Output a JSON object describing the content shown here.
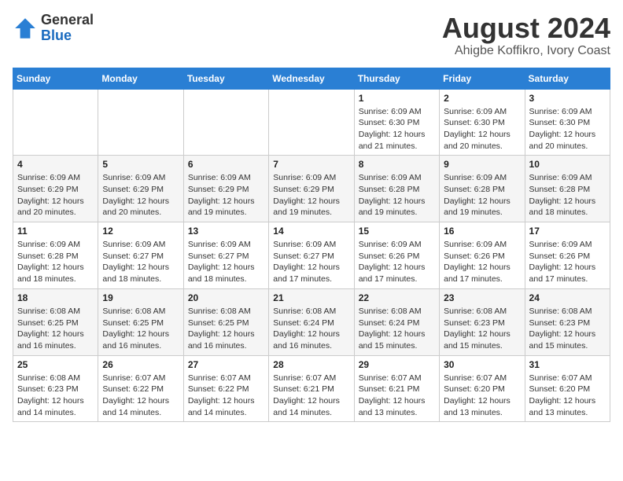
{
  "logo": {
    "general": "General",
    "blue": "Blue"
  },
  "header": {
    "month": "August 2024",
    "location": "Ahigbe Koffikro, Ivory Coast"
  },
  "weekdays": [
    "Sunday",
    "Monday",
    "Tuesday",
    "Wednesday",
    "Thursday",
    "Friday",
    "Saturday"
  ],
  "weeks": [
    [
      {
        "day": "",
        "info": ""
      },
      {
        "day": "",
        "info": ""
      },
      {
        "day": "",
        "info": ""
      },
      {
        "day": "",
        "info": ""
      },
      {
        "day": "1",
        "info": "Sunrise: 6:09 AM\nSunset: 6:30 PM\nDaylight: 12 hours\nand 21 minutes."
      },
      {
        "day": "2",
        "info": "Sunrise: 6:09 AM\nSunset: 6:30 PM\nDaylight: 12 hours\nand 20 minutes."
      },
      {
        "day": "3",
        "info": "Sunrise: 6:09 AM\nSunset: 6:30 PM\nDaylight: 12 hours\nand 20 minutes."
      }
    ],
    [
      {
        "day": "4",
        "info": "Sunrise: 6:09 AM\nSunset: 6:29 PM\nDaylight: 12 hours\nand 20 minutes."
      },
      {
        "day": "5",
        "info": "Sunrise: 6:09 AM\nSunset: 6:29 PM\nDaylight: 12 hours\nand 20 minutes."
      },
      {
        "day": "6",
        "info": "Sunrise: 6:09 AM\nSunset: 6:29 PM\nDaylight: 12 hours\nand 19 minutes."
      },
      {
        "day": "7",
        "info": "Sunrise: 6:09 AM\nSunset: 6:29 PM\nDaylight: 12 hours\nand 19 minutes."
      },
      {
        "day": "8",
        "info": "Sunrise: 6:09 AM\nSunset: 6:28 PM\nDaylight: 12 hours\nand 19 minutes."
      },
      {
        "day": "9",
        "info": "Sunrise: 6:09 AM\nSunset: 6:28 PM\nDaylight: 12 hours\nand 19 minutes."
      },
      {
        "day": "10",
        "info": "Sunrise: 6:09 AM\nSunset: 6:28 PM\nDaylight: 12 hours\nand 18 minutes."
      }
    ],
    [
      {
        "day": "11",
        "info": "Sunrise: 6:09 AM\nSunset: 6:28 PM\nDaylight: 12 hours\nand 18 minutes."
      },
      {
        "day": "12",
        "info": "Sunrise: 6:09 AM\nSunset: 6:27 PM\nDaylight: 12 hours\nand 18 minutes."
      },
      {
        "day": "13",
        "info": "Sunrise: 6:09 AM\nSunset: 6:27 PM\nDaylight: 12 hours\nand 18 minutes."
      },
      {
        "day": "14",
        "info": "Sunrise: 6:09 AM\nSunset: 6:27 PM\nDaylight: 12 hours\nand 17 minutes."
      },
      {
        "day": "15",
        "info": "Sunrise: 6:09 AM\nSunset: 6:26 PM\nDaylight: 12 hours\nand 17 minutes."
      },
      {
        "day": "16",
        "info": "Sunrise: 6:09 AM\nSunset: 6:26 PM\nDaylight: 12 hours\nand 17 minutes."
      },
      {
        "day": "17",
        "info": "Sunrise: 6:09 AM\nSunset: 6:26 PM\nDaylight: 12 hours\nand 17 minutes."
      }
    ],
    [
      {
        "day": "18",
        "info": "Sunrise: 6:08 AM\nSunset: 6:25 PM\nDaylight: 12 hours\nand 16 minutes."
      },
      {
        "day": "19",
        "info": "Sunrise: 6:08 AM\nSunset: 6:25 PM\nDaylight: 12 hours\nand 16 minutes."
      },
      {
        "day": "20",
        "info": "Sunrise: 6:08 AM\nSunset: 6:25 PM\nDaylight: 12 hours\nand 16 minutes."
      },
      {
        "day": "21",
        "info": "Sunrise: 6:08 AM\nSunset: 6:24 PM\nDaylight: 12 hours\nand 16 minutes."
      },
      {
        "day": "22",
        "info": "Sunrise: 6:08 AM\nSunset: 6:24 PM\nDaylight: 12 hours\nand 15 minutes."
      },
      {
        "day": "23",
        "info": "Sunrise: 6:08 AM\nSunset: 6:23 PM\nDaylight: 12 hours\nand 15 minutes."
      },
      {
        "day": "24",
        "info": "Sunrise: 6:08 AM\nSunset: 6:23 PM\nDaylight: 12 hours\nand 15 minutes."
      }
    ],
    [
      {
        "day": "25",
        "info": "Sunrise: 6:08 AM\nSunset: 6:23 PM\nDaylight: 12 hours\nand 14 minutes."
      },
      {
        "day": "26",
        "info": "Sunrise: 6:07 AM\nSunset: 6:22 PM\nDaylight: 12 hours\nand 14 minutes."
      },
      {
        "day": "27",
        "info": "Sunrise: 6:07 AM\nSunset: 6:22 PM\nDaylight: 12 hours\nand 14 minutes."
      },
      {
        "day": "28",
        "info": "Sunrise: 6:07 AM\nSunset: 6:21 PM\nDaylight: 12 hours\nand 14 minutes."
      },
      {
        "day": "29",
        "info": "Sunrise: 6:07 AM\nSunset: 6:21 PM\nDaylight: 12 hours\nand 13 minutes."
      },
      {
        "day": "30",
        "info": "Sunrise: 6:07 AM\nSunset: 6:20 PM\nDaylight: 12 hours\nand 13 minutes."
      },
      {
        "day": "31",
        "info": "Sunrise: 6:07 AM\nSunset: 6:20 PM\nDaylight: 12 hours\nand 13 minutes."
      }
    ]
  ]
}
